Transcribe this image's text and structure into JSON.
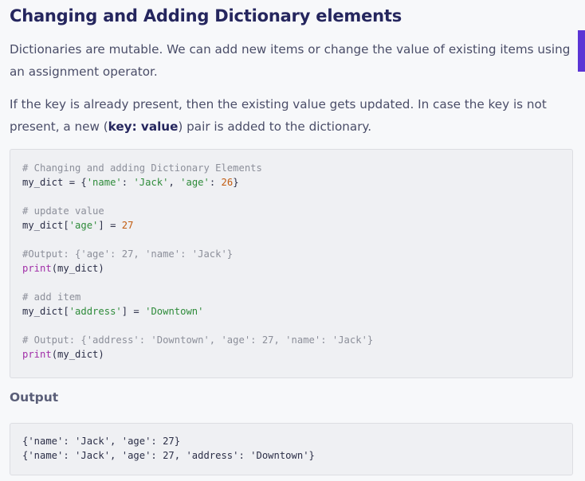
{
  "heading": "Changing and Adding Dictionary elements",
  "paragraph1": "Dictionaries are mutable. We can add new items or change the value of existing items using an assignment operator.",
  "paragraph2": {
    "before": "If the key is already present, then the existing value gets updated. In case the key is not present, a new (",
    "bold": "key: value",
    "after": ") pair is added to the dictionary."
  },
  "code_block": [
    [
      {
        "t": "cmt",
        "v": "# Changing and adding Dictionary Elements"
      }
    ],
    [
      {
        "t": "plain",
        "v": "my_dict = {"
      },
      {
        "t": "str",
        "v": "'name'"
      },
      {
        "t": "plain",
        "v": ": "
      },
      {
        "t": "str",
        "v": "'Jack'"
      },
      {
        "t": "plain",
        "v": ", "
      },
      {
        "t": "str",
        "v": "'age'"
      },
      {
        "t": "plain",
        "v": ": "
      },
      {
        "t": "num",
        "v": "26"
      },
      {
        "t": "plain",
        "v": "}"
      }
    ],
    [],
    [
      {
        "t": "cmt",
        "v": "# update value"
      }
    ],
    [
      {
        "t": "plain",
        "v": "my_dict["
      },
      {
        "t": "str",
        "v": "'age'"
      },
      {
        "t": "plain",
        "v": "] = "
      },
      {
        "t": "num",
        "v": "27"
      }
    ],
    [],
    [
      {
        "t": "cmt",
        "v": "#Output: {'age': 27, 'name': 'Jack'}"
      }
    ],
    [
      {
        "t": "kw",
        "v": "print"
      },
      {
        "t": "plain",
        "v": "(my_dict)"
      }
    ],
    [],
    [
      {
        "t": "cmt",
        "v": "# add item"
      }
    ],
    [
      {
        "t": "plain",
        "v": "my_dict["
      },
      {
        "t": "str",
        "v": "'address'"
      },
      {
        "t": "plain",
        "v": "] = "
      },
      {
        "t": "str",
        "v": "'Downtown'"
      }
    ],
    [],
    [
      {
        "t": "cmt",
        "v": "# Output: {'address': 'Downtown', 'age': 27, 'name': 'Jack'}"
      }
    ],
    [
      {
        "t": "kw",
        "v": "print"
      },
      {
        "t": "plain",
        "v": "(my_dict)"
      }
    ]
  ],
  "output_heading": "Output",
  "output_lines": [
    "{'name': 'Jack', 'age': 27}",
    "{'name': 'Jack', 'age': 27, 'address': 'Downtown'}"
  ],
  "colors": {
    "heading": "#25265e",
    "code_bg": "#eff0f3",
    "comment": "#8c8f9a",
    "string": "#2e8b3a",
    "number": "#c25c10",
    "keyword": "#a12fa8",
    "accent": "#5b35d5"
  }
}
